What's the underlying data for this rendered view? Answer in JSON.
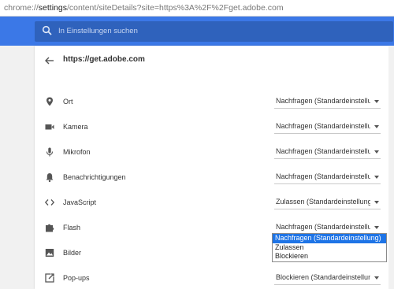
{
  "address_bar": {
    "prefix": "chrome://",
    "host": "settings",
    "path": "/content/siteDetails?site=https%3A%2F%2Fget.adobe.com"
  },
  "search": {
    "placeholder": "In Einstellungen suchen",
    "icon": "search-icon"
  },
  "site": {
    "title": "https://get.adobe.com",
    "back_icon": "arrow-left-icon"
  },
  "permissions": [
    {
      "icon": "location-pin-icon",
      "label": "Ort",
      "value": "Nachfragen (Standardeinstellung)"
    },
    {
      "icon": "camera-icon",
      "label": "Kamera",
      "value": "Nachfragen (Standardeinstellung)"
    },
    {
      "icon": "microphone-icon",
      "label": "Mikrofon",
      "value": "Nachfragen (Standardeinstellung)"
    },
    {
      "icon": "bell-icon",
      "label": "Benachrichtigungen",
      "value": "Nachfragen (Standardeinstellung)"
    },
    {
      "icon": "code-icon",
      "label": "JavaScript",
      "value": "Zulassen (Standardeinstellung)"
    },
    {
      "icon": "puzzle-icon",
      "label": "Flash",
      "value": "Nachfragen (Standardeinstellung)"
    },
    {
      "icon": "image-icon",
      "label": "Bilder",
      "value": ""
    },
    {
      "icon": "popup-icon",
      "label": "Pop-ups",
      "value": "Blockieren (Standardeinstellung)"
    }
  ],
  "flash_dropdown": {
    "options": [
      "Nachfragen (Standardeinstellung)",
      "Zulassen",
      "Blockieren"
    ],
    "selected": "Nachfragen (Standardeinstellung)"
  },
  "colors": {
    "header": "#3b78e7",
    "search_bg": "#2f62bc",
    "selected_option": "#1e74e6"
  }
}
